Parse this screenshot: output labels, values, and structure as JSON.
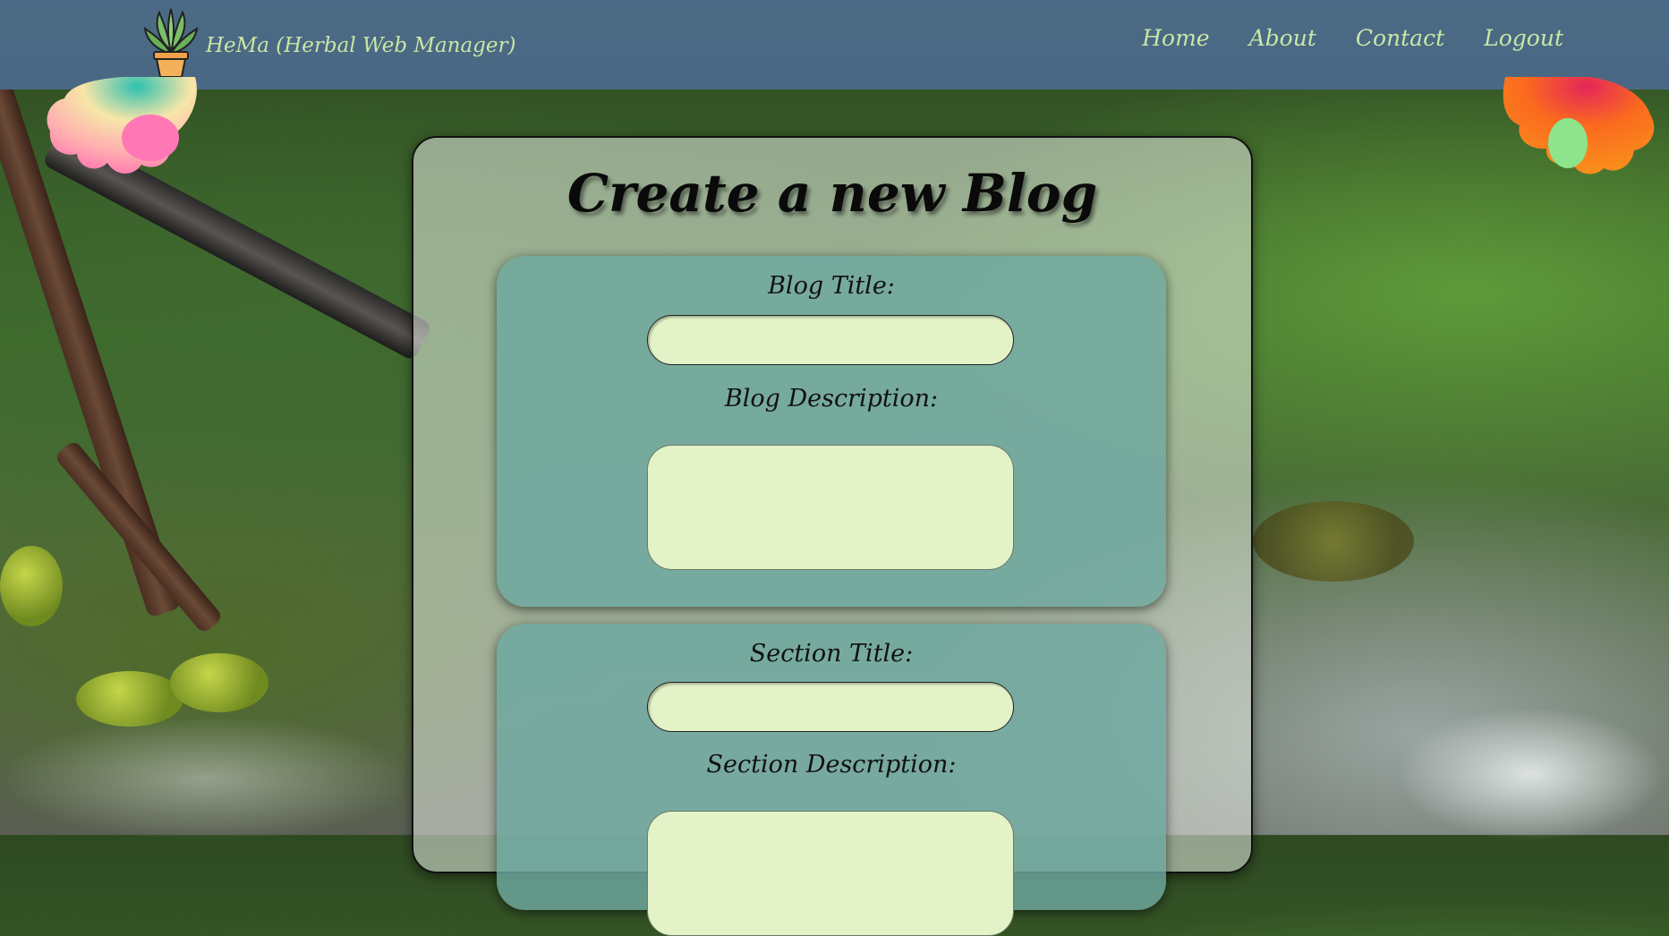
{
  "navbar": {
    "brand": "HeMa (Herbal Web Manager)",
    "logo_icon": "potted-plant-icon",
    "links": [
      {
        "label": "Home"
      },
      {
        "label": "About"
      },
      {
        "label": "Contact"
      },
      {
        "label": "Logout"
      }
    ]
  },
  "main": {
    "title": "Create a new Blog",
    "blog_card": {
      "title_label": "Blog Title:",
      "title_value": "",
      "description_label": "Blog Description:",
      "description_value": ""
    },
    "section_card": {
      "title_label": "Section Title:",
      "title_value": "",
      "description_label": "Section Description:",
      "description_value": ""
    }
  },
  "colors": {
    "navbar": "#4a6883",
    "nav_text": "#c9e6a7",
    "card": "#6ea8a0",
    "input": "#e4f3c7"
  }
}
